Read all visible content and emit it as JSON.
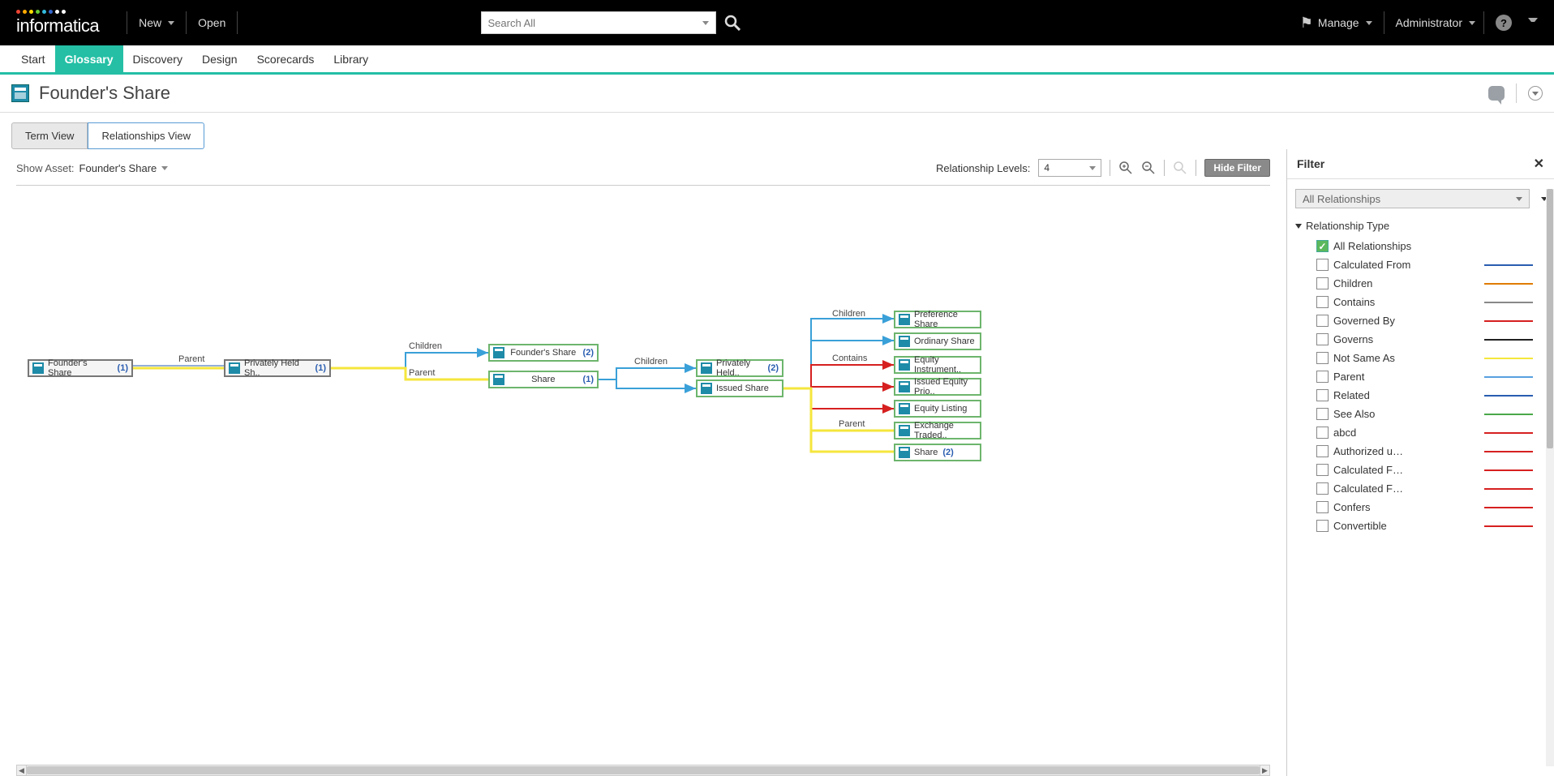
{
  "topbar": {
    "new_label": "New",
    "open_label": "Open",
    "search_placeholder": "Search All",
    "manage_label": "Manage",
    "admin_label": "Administrator",
    "help_glyph": "?"
  },
  "navtabs": {
    "start": "Start",
    "glossary": "Glossary",
    "discovery": "Discovery",
    "design": "Design",
    "scorecards": "Scorecards",
    "library": "Library"
  },
  "page": {
    "title": "Founder's Share"
  },
  "viewtabs": {
    "term": "Term View",
    "relationships": "Relationships View"
  },
  "toolbar": {
    "show_asset_label": "Show Asset:",
    "show_asset_value": "Founder's Share",
    "levels_label": "Relationship Levels:",
    "levels_value": "4",
    "hide_filter_label": "Hide Filter"
  },
  "graph": {
    "nodes": {
      "n1": {
        "label": "Founder's Share",
        "count": "(1)"
      },
      "n2": {
        "label": "Privately Held Sh..",
        "count": "(1)"
      },
      "n3": {
        "label": "Founder's Share",
        "count": "(2)"
      },
      "n4": {
        "label": "Share",
        "count": "(1)"
      },
      "n5": {
        "label": "Privately Held..",
        "count": "(2)"
      },
      "n6": {
        "label": "Issued Share",
        "count": ""
      },
      "n7": {
        "label": "Preference Share",
        "count": ""
      },
      "n8": {
        "label": "Ordinary Share",
        "count": ""
      },
      "n9": {
        "label": "Equity Instrument..",
        "count": ""
      },
      "n10": {
        "label": "Issued Equity Prio..",
        "count": ""
      },
      "n11": {
        "label": "Equity Listing",
        "count": ""
      },
      "n12": {
        "label": "Exchange Traded..",
        "count": ""
      },
      "n13": {
        "label": "Share",
        "count": "(2)"
      }
    },
    "edge_labels": {
      "e1": "Parent",
      "e2": "Children",
      "e3": "Parent",
      "e4": "Children",
      "e5": "Children",
      "e6": "Contains",
      "e7": "Parent"
    }
  },
  "filter": {
    "title": "Filter",
    "select_label": "All Relationships",
    "tree_title": "Relationship Type",
    "items": [
      {
        "label": "All Relationships",
        "checked": true,
        "color": null
      },
      {
        "label": "Calculated From",
        "checked": false,
        "color": "#2a5db0"
      },
      {
        "label": "Children",
        "checked": false,
        "color": "#e07b00"
      },
      {
        "label": "Contains",
        "checked": false,
        "color": "#888888"
      },
      {
        "label": "Governed By",
        "checked": false,
        "color": "#d62020"
      },
      {
        "label": "Governs",
        "checked": false,
        "color": "#222222"
      },
      {
        "label": "Not Same As",
        "checked": false,
        "color": "#f5e63d"
      },
      {
        "label": "Parent",
        "checked": false,
        "color": "#58a0e0"
      },
      {
        "label": "Related",
        "checked": false,
        "color": "#2a5db0"
      },
      {
        "label": "See Also",
        "checked": false,
        "color": "#4aa84a"
      },
      {
        "label": "abcd",
        "checked": false,
        "color": "#d62020"
      },
      {
        "label": "Authorized u…",
        "checked": false,
        "color": "#d62020"
      },
      {
        "label": "Calculated F…",
        "checked": false,
        "color": "#d62020"
      },
      {
        "label": "Calculated F…",
        "checked": false,
        "color": "#d62020"
      },
      {
        "label": "Confers",
        "checked": false,
        "color": "#d62020"
      },
      {
        "label": "Convertible",
        "checked": false,
        "color": "#d62020"
      }
    ]
  }
}
